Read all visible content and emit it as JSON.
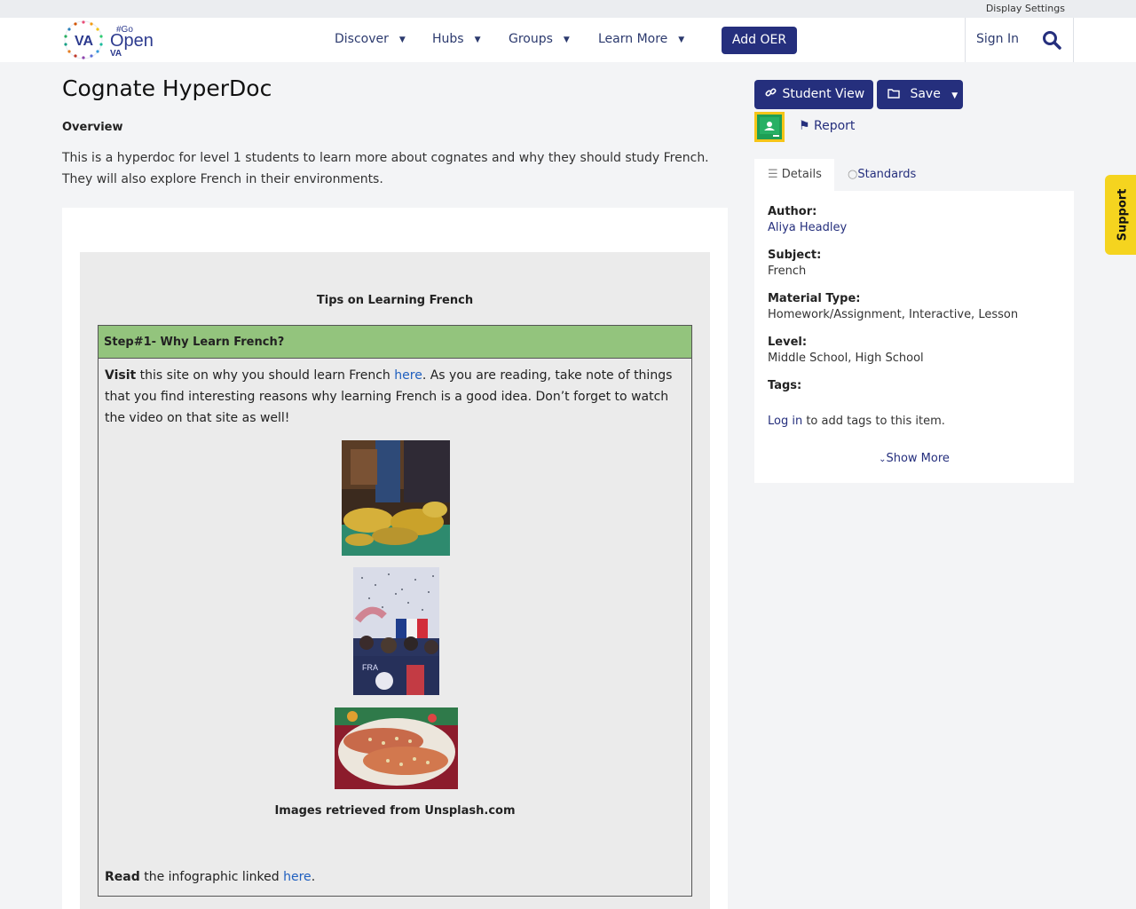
{
  "topbar": {
    "display_settings": "Display Settings"
  },
  "nav": {
    "logo_text_a": "VA",
    "logo_text_b": "#Go",
    "logo_text_c": "Open",
    "logo_text_d": "VA",
    "items": [
      {
        "label": "Discover"
      },
      {
        "label": "Hubs"
      },
      {
        "label": "Groups"
      },
      {
        "label": "Learn More"
      }
    ],
    "add_oer": "Add OER",
    "sign_in": "Sign In"
  },
  "resource": {
    "title": "Cognate HyperDoc",
    "overview_heading": "Overview",
    "overview_text": "This is a hyperdoc for level 1 students to learn more about cognates and why they should study French. They will also explore French in their environments."
  },
  "doc": {
    "tips_heading": "Tips on Learning French",
    "step_heading": "Step#1- Why Learn French?",
    "visit_bold": "Visit",
    "visit_pre": " this site on why you should learn French ",
    "visit_link": "here",
    "visit_post": ". As you are reading, take note of things that you find interesting reasons why learning French is a good idea. Don’t forget to watch the video on that site as well!",
    "images_credit": "Images retrieved from Unsplash.com",
    "read_bold": "Read",
    "read_pre": " the infographic linked ",
    "read_link": "here",
    "read_post": "."
  },
  "actions": {
    "student_view": "Student View",
    "save": "Save",
    "report": "Report"
  },
  "tabs": {
    "details": "Details",
    "standards": "Standards"
  },
  "details": {
    "author_label": "Author:",
    "author_value": "Aliya Headley",
    "subject_label": "Subject:",
    "subject_value": "French",
    "material_label": "Material Type:",
    "material_value": "Homework/Assignment, Interactive, Lesson",
    "level_label": "Level:",
    "level_value": "Middle School, High School",
    "tags_label": "Tags:",
    "login_link": "Log in",
    "login_rest": " to add tags to this item.",
    "show_more": "Show More"
  },
  "support": "Support",
  "colors": {
    "primary": "#252f7d",
    "step_green": "#93c47d",
    "support_yellow": "#f5d41f",
    "link_blue": "#1f5fbf"
  },
  "icons": [
    "chevron-down-icon",
    "search-icon",
    "link-icon",
    "folder-icon",
    "caret-down-icon",
    "google-classroom-icon",
    "flag-icon",
    "list-icon",
    "circle-icon"
  ]
}
